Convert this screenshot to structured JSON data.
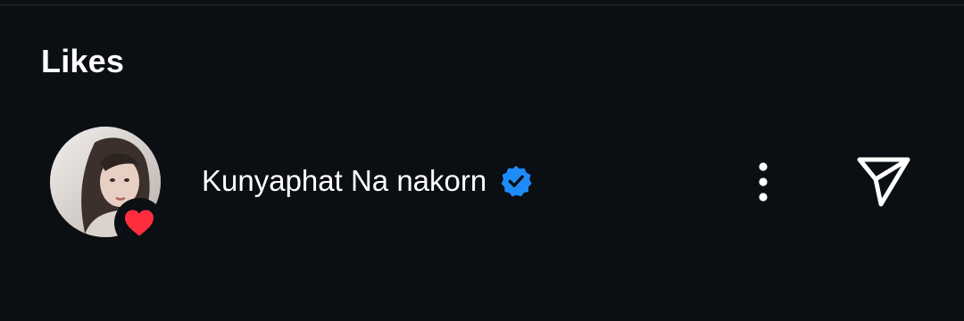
{
  "header": {
    "title": "Likes"
  },
  "likes": [
    {
      "username": "Kunyaphat Na nakorn",
      "verified": true,
      "avatar_icon": "profile-photo",
      "badge_icon": "heart-icon",
      "badge_color": "#ff2d3d",
      "verified_color": "#1d8cf8"
    }
  ],
  "actions": {
    "more_icon": "more-vertical-icon",
    "send_icon": "send-icon"
  },
  "colors": {
    "background": "#0b0e13",
    "text": "#ffffff"
  }
}
